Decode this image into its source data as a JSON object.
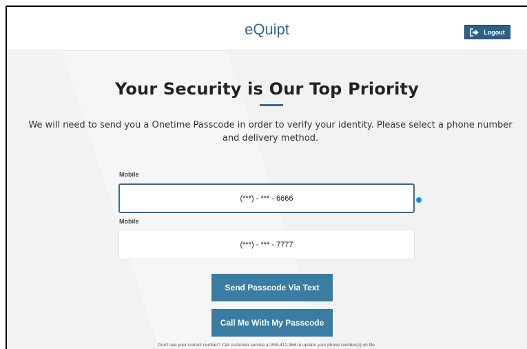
{
  "header": {
    "logo": "eQuipt",
    "logout_label": "Logout"
  },
  "main": {
    "title": "Your Security is Our Top Priority",
    "description": "We will need to send you a Onetime Passcode in order to verify your identity. Please select a phone number and delivery method.",
    "phones": [
      {
        "label": "Mobile",
        "number": "(***) - *** - 6666",
        "selected": true
      },
      {
        "label": "Mobile",
        "number": "(***) - *** - 7777",
        "selected": false
      }
    ],
    "buttons": {
      "text": "Send Passcode Via Text",
      "call": "Call Me With My Passcode"
    },
    "footnote": "Don't see your correct number? Call customer service at 855-412-366  to update your phone number(s) on file."
  },
  "colors": {
    "brand": "#356b93",
    "button": "#3a7ca3",
    "selected_dot": "#1d8ce0"
  },
  "icons": {
    "logout": "logout-arrow-icon"
  }
}
